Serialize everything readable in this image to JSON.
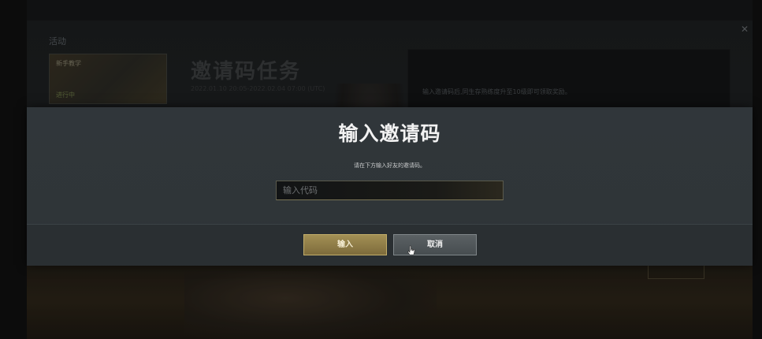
{
  "background": {
    "section_title": "活动",
    "card": {
      "label": "新手教学",
      "status": "进行中"
    },
    "event_title": "邀请码任务",
    "event_date": "2022.01.10 20:05-2022.02.04 07:00 (UTC)",
    "panel_text": "输入邀请码后,同生存熟练度升至10级即可领取奖励。",
    "close_icon": "close-icon"
  },
  "modal": {
    "title": "输入邀请码",
    "description": "请在下方输入好友的邀请码。",
    "input": {
      "placeholder": "输入代码",
      "value": ""
    },
    "confirm_label": "输入",
    "cancel_label": "取消"
  },
  "colors": {
    "accent_gold": "#a39055",
    "modal_bg": "#30363a",
    "cancel_gray": "#5b6164"
  },
  "cursor": "pointer-cursor-icon"
}
